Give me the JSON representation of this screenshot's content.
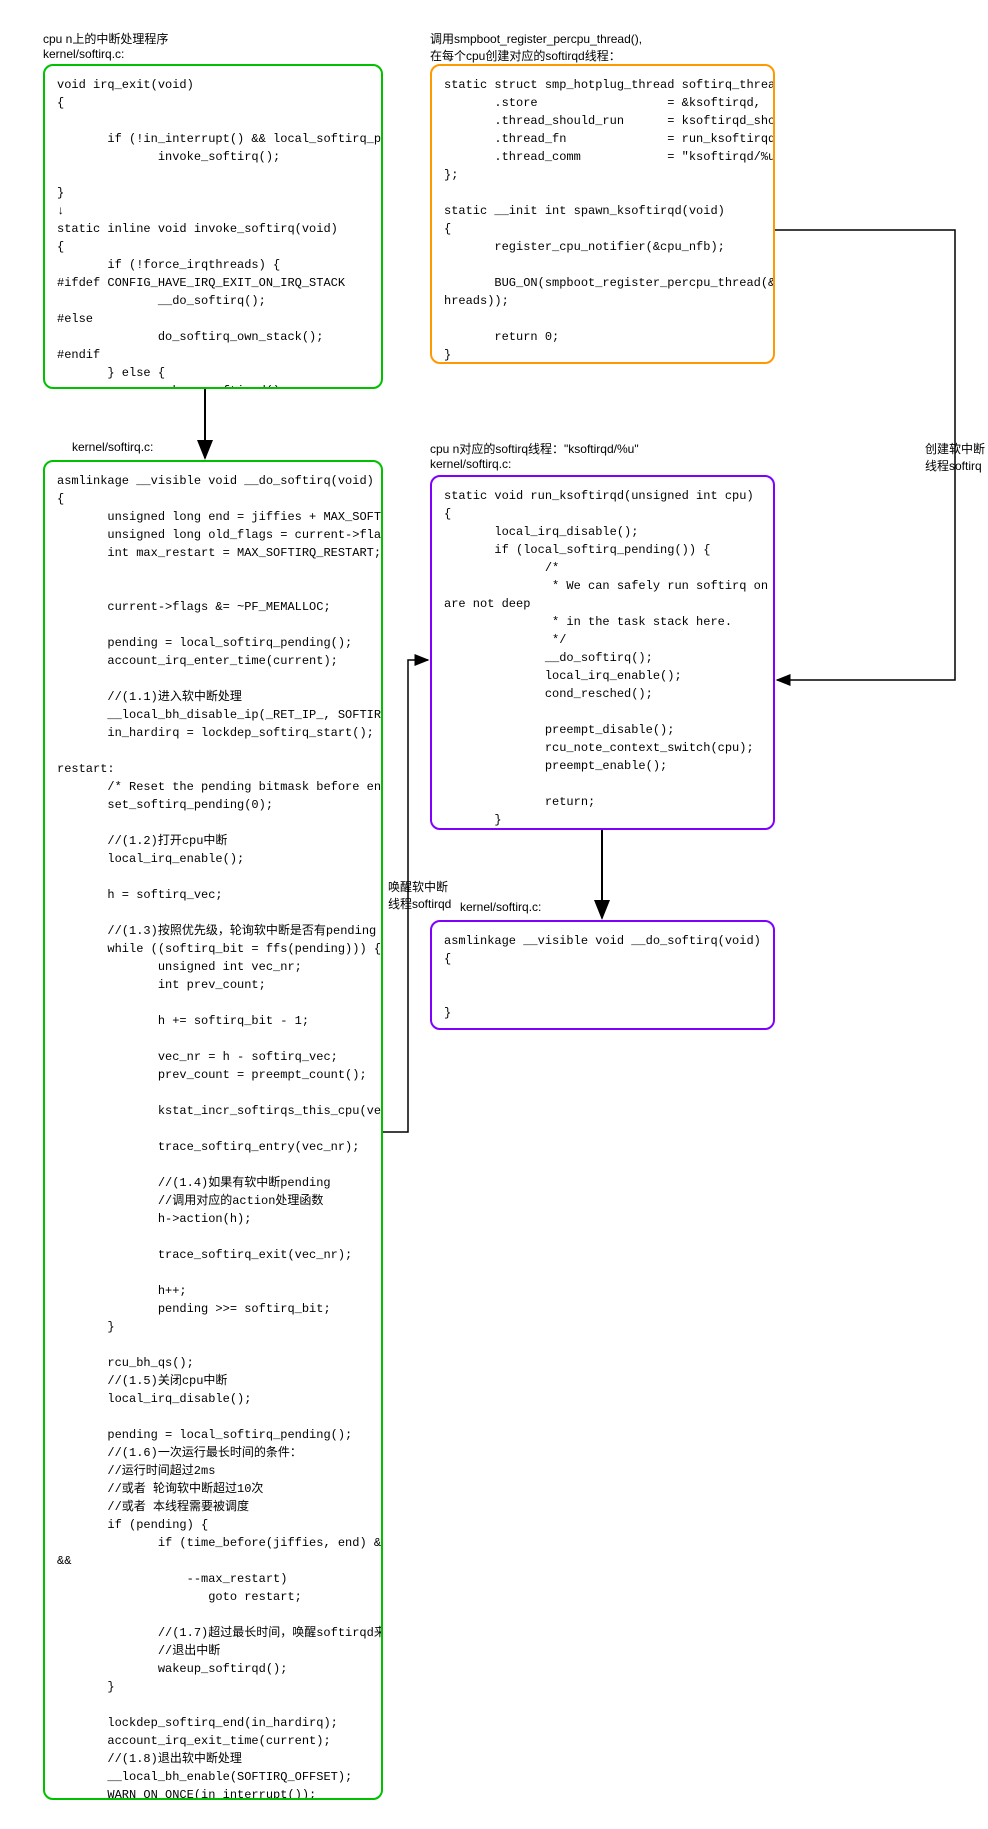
{
  "labels": {
    "box1_title": "cpu n上的中断处理程序\nkernel/softirq.c:",
    "box2_title": "kernel/softirq.c:",
    "box3_title": "调用smpboot_register_percpu_thread(),\n在每个cpu创建对应的softirqd线程：",
    "box4_title": "cpu n对应的softirq线程：\"ksoftirqd/%u\"\nkernel/softirq.c:",
    "box5_title": "kernel/softirq.c:",
    "arrow_left_label": "唤醒软中断\n线程softirqd",
    "arrow_right_label": "创建软中断\n线程softirq"
  },
  "code": {
    "box1": "void irq_exit(void)\n{\n\n       if (!in_interrupt() && local_softirq_pending())\n              invoke_softirq();\n\n}\n↓\nstatic inline void invoke_softirq(void)\n{\n       if (!force_irqthreads) {\n#ifdef CONFIG_HAVE_IRQ_EXIT_ON_IRQ_STACK\n              __do_softirq();\n#else\n              do_softirq_own_stack();\n#endif\n       } else {\n              wakeup_softirqd();\n       }\n}",
    "box2": "asmlinkage __visible void __do_softirq(void)\n{\n       unsigned long end = jiffies + MAX_SOFTIRQ_TIME;\n       unsigned long old_flags = current->flags;\n       int max_restart = MAX_SOFTIRQ_RESTART;\n\n\n       current->flags &= ~PF_MEMALLOC;\n\n       pending = local_softirq_pending();\n       account_irq_enter_time(current);\n\n       //(1.1)进入软中断处理\n       __local_bh_disable_ip(_RET_IP_, SOFTIRQ_OFFSET);\n       in_hardirq = lockdep_softirq_start();\n\nrestart:\n       /* Reset the pending bitmask before enabling irqs */\n       set_softirq_pending(0);\n\n       //(1.2)打开cpu中断\n       local_irq_enable();\n\n       h = softirq_vec;\n\n       //(1.3)按照优先级，轮询软中断是否有pending\n       while ((softirq_bit = ffs(pending))) {\n              unsigned int vec_nr;\n              int prev_count;\n\n              h += softirq_bit - 1;\n\n              vec_nr = h - softirq_vec;\n              prev_count = preempt_count();\n\n              kstat_incr_softirqs_this_cpu(vec_nr);\n\n              trace_softirq_entry(vec_nr);\n\n              //(1.4)如果有软中断pending\n              //调用对应的action处理函数\n              h->action(h);\n\n              trace_softirq_exit(vec_nr);\n\n              h++;\n              pending >>= softirq_bit;\n       }\n\n       rcu_bh_qs();\n       //(1.5)关闭cpu中断\n       local_irq_disable();\n\n       pending = local_softirq_pending();\n       //(1.6)一次运行最长时间的条件：\n       //运行时间超过2ms\n       //或者 轮询软中断超过10次\n       //或者 本线程需要被调度\n       if (pending) {\n              if (time_before(jiffies, end) && !need_resched()\n&&\n                  --max_restart)\n                     goto restart;\n\n              //(1.7)超过最长时间，唤醒softirqd来处理\n              //退出中断\n              wakeup_softirqd();\n       }\n\n       lockdep_softirq_end(in_hardirq);\n       account_irq_exit_time(current);\n       //(1.8)退出软中断处理\n       __local_bh_enable(SOFTIRQ_OFFSET);\n       WARN_ON_ONCE(in_interrupt());\n       tsk_restore_flags(current, old_flags, PF_MEMALLOC);\n}",
    "box3": "static struct smp_hotplug_thread softirq_threads = {\n       .store                  = &ksoftirqd,\n       .thread_should_run      = ksoftirqd_should_run,\n       .thread_fn              = run_ksoftirqd,\n       .thread_comm            = \"ksoftirqd/%u\",\n};\n\nstatic __init int spawn_ksoftirqd(void)\n{\n       register_cpu_notifier(&cpu_nfb);\n\n       BUG_ON(smpboot_register_percpu_thread(&softirq_t\nhreads));\n\n       return 0;\n}\nearly_initcall(spawn_ksoftirqd);",
    "box4": "static void run_ksoftirqd(unsigned int cpu)\n{\n       local_irq_disable();\n       if (local_softirq_pending()) {\n              /*\n               * We can safely run softirq on inline stack, as we\nare not deep\n               * in the task stack here.\n               */\n              __do_softirq();\n              local_irq_enable();\n              cond_resched();\n\n              preempt_disable();\n              rcu_note_context_switch(cpu);\n              preempt_enable();\n\n              return;\n       }\n       local_irq_enable();\n}",
    "box5": "asmlinkage __visible void __do_softirq(void)\n{\n\n\n}"
  }
}
